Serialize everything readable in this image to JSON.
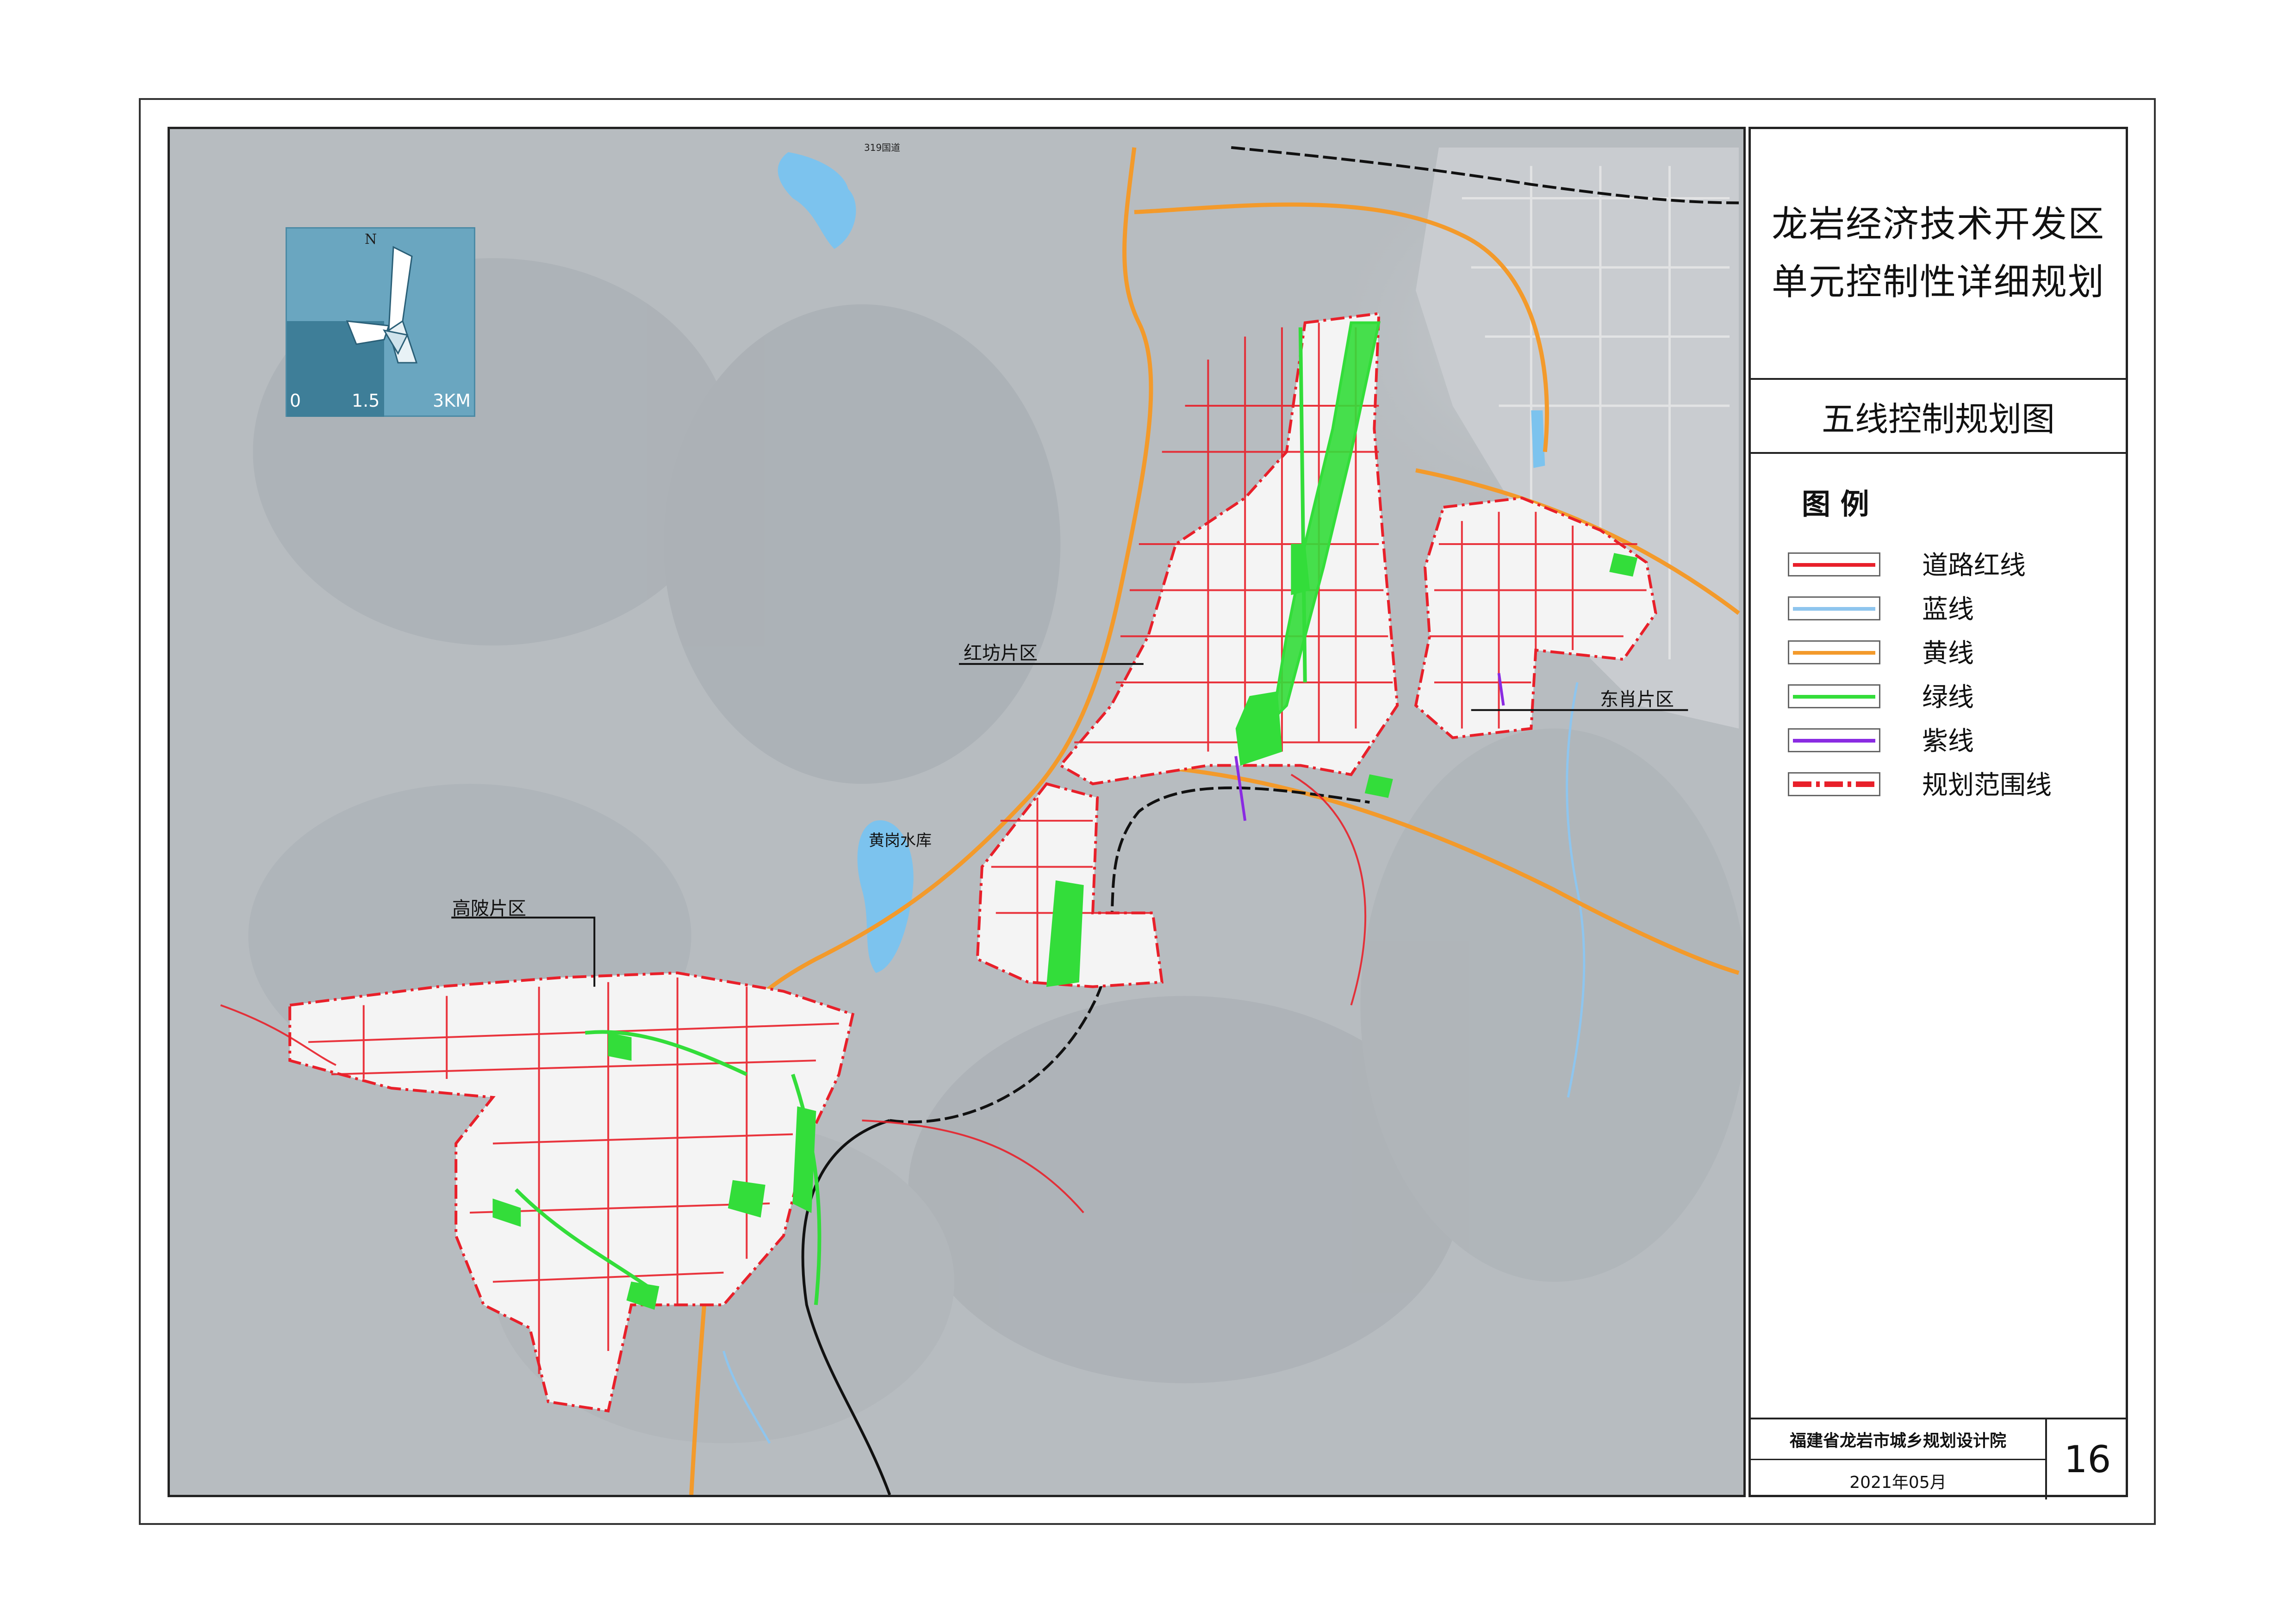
{
  "title": {
    "line1": "龙岩经济技术开发区",
    "line2": "单元控制性详细规划"
  },
  "subtitle": "五线控制规划图",
  "legend": {
    "heading": "图 例",
    "items": [
      {
        "label": "道路红线",
        "color": "#e8202a",
        "style": "solid"
      },
      {
        "label": "蓝线",
        "color": "#8ec5ee",
        "style": "solid"
      },
      {
        "label": "黄线",
        "color": "#f39a2b",
        "style": "solid"
      },
      {
        "label": "绿线",
        "color": "#33dd3a",
        "style": "solid"
      },
      {
        "label": "紫线",
        "color": "#8a2be2",
        "style": "solid"
      },
      {
        "label": "规划范围线",
        "color": "#e8202a",
        "style": "dash-dot"
      }
    ]
  },
  "footer": {
    "institute": "福建省龙岩市城乡规划设计院",
    "date": "2021年05月",
    "page": "16"
  },
  "compass": {
    "north": "N",
    "scale_labels": [
      "0",
      "1.5",
      "3KM"
    ]
  },
  "map_labels": {
    "hongfang": "红坊片区",
    "dongxiao": "东肖片区",
    "gaopo": "高陂片区",
    "huanggang": "黄岗水库",
    "road_319": "319国道"
  },
  "colors": {
    "terrain": "#b9bec2",
    "water": "#7cc3ee",
    "road_red": "#e8202a",
    "green": "#33dd3a",
    "orange": "#f39a2b",
    "compass_bg": "#6aa6c0"
  }
}
